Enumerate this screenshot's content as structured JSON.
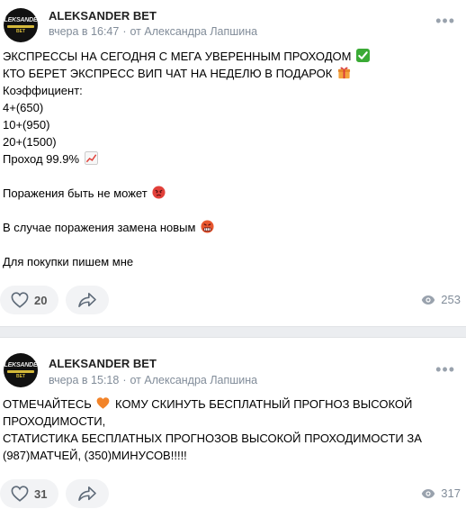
{
  "posts": [
    {
      "author": "ALEKSANDER BET",
      "avatar_line1": "ALEKSANDER",
      "avatar_line2": "BET",
      "time": "вчера в 16:47",
      "separator": "·",
      "source": "от Александра Лапшина",
      "lines": [
        "ЭКСПРЕССЫ НА СЕГОДНЯ С МЕГА УВЕРЕННЫМ ПРОХОДОМ",
        "КТО БЕРЕТ ЭКСПРЕСС ВИП ЧАТ НА НЕДЕЛЮ В ПОДАРОК",
        "Коэффициент:",
        "4+(650)",
        "10+(950)",
        "20+(1500)",
        "Проход 99.9%",
        "",
        "Поражения быть не может",
        "",
        "В случае поражения замена новым",
        "",
        "Для покупки пишем мне"
      ],
      "likes": "20",
      "views": "253"
    },
    {
      "author": "ALEKSANDER BET",
      "avatar_line1": "ALEKSANDER",
      "avatar_line2": "BET",
      "time": "вчера в 15:18",
      "separator": "·",
      "source": "от Александра Лапшина",
      "line1_before": "ОТМЕЧАЙТЕСЬ",
      "line1_after": "КОМУ СКИНУТЬ БЕСПЛАТНЫЙ ПРОГНОЗ ВЫСОКОЙ",
      "lines": [
        "ПРОХОДИМОСТИ,",
        "СТАТИСТИКА БЕСПЛАТНЫХ ПРОГНОЗОВ ВЫСОКОЙ ПРОХОДИМОСТИ ЗА",
        "(987)МАТЧЕЙ, (350)МИНУСОВ!!!!!"
      ],
      "likes": "31",
      "views": "317"
    }
  ],
  "icons": {
    "like": "heart-outline-icon",
    "share": "share-arrow-icon",
    "views": "eye-icon",
    "more": "more-horizontal-icon"
  },
  "colors": {
    "meta": "#818c99",
    "button_bg": "#f2f3f5",
    "separator_bg": "#ebedf0",
    "avatar_gold": "#d4b93a"
  }
}
